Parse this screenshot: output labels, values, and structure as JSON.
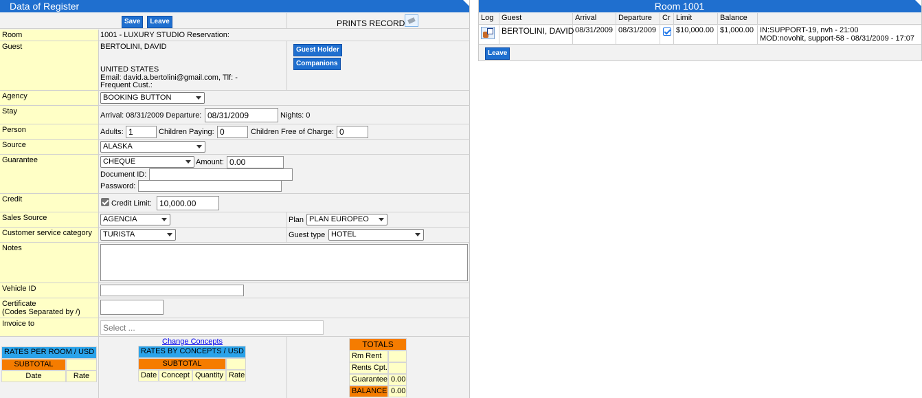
{
  "register": {
    "title": "Data of Register",
    "save_label": "Save",
    "leave_label": "Leave",
    "prints_label": "PRINTS RECORD:",
    "fields": {
      "room_label": "Room",
      "room_value": "1001 - LUXURY STUDIO Reservation:",
      "guest_label": "Guest",
      "guest_name": "BERTOLINI, DAVID",
      "guest_country": "UNITED STATES",
      "guest_email": "Email: david.a.bertolini@gmail.com, Tlf: -",
      "guest_frequent": "Frequent Cust.:",
      "guest_holder_label": "Guest Holder",
      "companions_label": "Companions",
      "agency_label": "Agency",
      "agency_value": "BOOKING BUTTON",
      "stay_label": "Stay",
      "arrival_text": "Arrival: 08/31/2009 Departure:",
      "departure_value": "08/31/2009",
      "nights_text": "Nights: 0",
      "person_label": "Person",
      "adults_label": "Adults:",
      "adults_value": "1",
      "children_paying_label": "Children Paying:",
      "children_paying_value": "0",
      "children_free_label": "Children Free of Charge:",
      "children_free_value": "0",
      "source_label": "Source",
      "source_value": "ALASKA",
      "guarantee_label": "Guarantee",
      "guarantee_value": "CHEQUE",
      "amount_label": "Amount:",
      "amount_value": "0.00",
      "document_label": "Document ID:",
      "document_value": "",
      "password_label": "Password:",
      "password_value": "",
      "credit_label": "Credit",
      "credit_limit_label": "Credit Limit:",
      "credit_limit_value": "10,000.00",
      "credit_checked": true,
      "sales_source_label": "Sales Source",
      "sales_source_value": "AGENCIA",
      "plan_label": "Plan",
      "plan_value": "PLAN EUROPEO",
      "customer_category_label": "Customer service category",
      "customer_category_value": "TURISTA",
      "guest_type_label": "Guest type",
      "guest_type_value": "HOTEL",
      "notes_label": "Notes",
      "notes_value": "",
      "vehicle_label": "Vehicle ID",
      "vehicle_value": "",
      "certificate_label": "Certificate",
      "certificate_sub": "(Codes Separated by /)",
      "certificate_value": "",
      "invoice_label": "Invoice to",
      "invoice_placeholder": "Select ..."
    },
    "rates_room": {
      "title": "RATES PER ROOM / USD",
      "subtotal": "SUBTOTAL",
      "col_date": "Date",
      "col_rate": "Rate"
    },
    "change_concepts": "Change Concepts",
    "rates_concepts": {
      "title": "RATES BY CONCEPTS / USD",
      "subtotal": "SUBTOTAL",
      "col_date": "Date",
      "col_concept": "Concept",
      "col_quantity": "Quantity",
      "col_rate": "Rate"
    },
    "totals": {
      "title": "TOTALS",
      "rm_rent": "Rm Rent",
      "rm_rent_value": "",
      "rents_cpt": "Rents Cpt.",
      "rents_cpt_value": "",
      "guarantee": "Guarantee",
      "guarantee_value": "0.00",
      "balance": "BALANCE",
      "balance_value": "0.00"
    }
  },
  "room": {
    "title": "Room 1001",
    "headers": {
      "log": "Log",
      "guest": "Guest",
      "arrival": "Arrival",
      "departure": "Departure",
      "cr": "Cr",
      "limit": "Limit",
      "balance": "Balance"
    },
    "row": {
      "guest": "BERTOLINI, DAVID",
      "arrival": "08/31/2009",
      "departure": "08/31/2009",
      "cr_checked": true,
      "limit": "$10,000.00",
      "balance": "$1,000.00",
      "info_line1": "IN:SUPPORT-19, nvh - 21:00",
      "info_line2": "MOD:novohit, support-58 - 08/31/2009 - 17:07"
    },
    "leave_label": "Leave"
  }
}
